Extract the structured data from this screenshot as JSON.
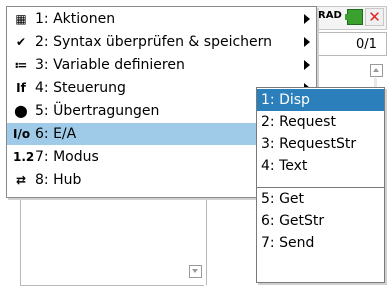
{
  "status": {
    "angle_mode": "RAD",
    "page": "0/1",
    "close_glyph": "✕"
  },
  "menu": {
    "items": [
      {
        "label": "1: Aktionen",
        "icon": "actions-icon",
        "glyph": "▦",
        "has_submenu": true
      },
      {
        "label": "2: Syntax überprüfen & speichern",
        "icon": "check-syntax-icon",
        "glyph": "✔",
        "has_submenu": true
      },
      {
        "label": "3: Variable definieren",
        "icon": "define-variable-icon",
        "glyph": "≔",
        "has_submenu": true
      },
      {
        "label": "4: Steuerung",
        "icon": "control-icon",
        "glyph": "If",
        "has_submenu": true
      },
      {
        "label": "5: Übertragungen",
        "icon": "transfers-icon",
        "glyph": "⬤",
        "has_submenu": true
      },
      {
        "label": "6: E/A",
        "icon": "io-icon",
        "glyph": "I/o",
        "has_submenu": false,
        "selected": true
      },
      {
        "label": "7: Modus",
        "icon": "mode-icon",
        "glyph": "1.2",
        "has_submenu": true
      },
      {
        "label": "8: Hub",
        "icon": "hub-icon",
        "glyph": "⇄",
        "has_submenu": true
      }
    ]
  },
  "submenu": {
    "items": [
      {
        "label": "1: Disp",
        "selected": true
      },
      {
        "label": "2: Request"
      },
      {
        "label": "3: RequestStr"
      },
      {
        "label": "4: Text"
      },
      {
        "label": "5: Get"
      },
      {
        "label": "6: GetStr"
      },
      {
        "label": "7: Send"
      }
    ]
  },
  "colors": {
    "menu_highlight": "#9fcbe8",
    "submenu_highlight": "#2b7fbb",
    "close_red": "#e02424",
    "battery_green": "#3aa02e"
  }
}
